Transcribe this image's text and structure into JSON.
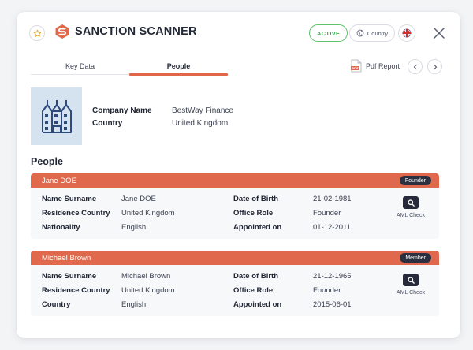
{
  "header": {
    "brand_name": "SANCTION SCANNER",
    "status_badge": "ACTIVE",
    "country_button": "Country"
  },
  "tabs": [
    {
      "label": "Key Data",
      "active": false
    },
    {
      "label": "People",
      "active": true
    }
  ],
  "toolbar": {
    "pdf_label": "Pdf Report",
    "pdf_icon_text": "PDF"
  },
  "company": {
    "name_label": "Company Name",
    "name_value": "BestWay Finance",
    "country_label": "Country",
    "country_value": "United Kingdom"
  },
  "people_title": "People",
  "people": [
    {
      "name": "Jane DOE",
      "role_badge": "Founder",
      "fields": {
        "name_surname_label": "Name Surname",
        "name_surname": "Jane DOE",
        "residence_label": "Residence Country",
        "residence": "United Kingdom",
        "country_label": "Nationality",
        "country": "English",
        "dob_label": "Date of Birth",
        "dob": "21-02-1981",
        "office_role_label": "Office Role",
        "office_role": "Founder",
        "appointed_label": "Appointed on",
        "appointed": "01-12-2011"
      },
      "aml_label": "AML Check"
    },
    {
      "name": "Michael Brown",
      "role_badge": "Member",
      "fields": {
        "name_surname_label": "Name Surname",
        "name_surname": "Michael Brown",
        "residence_label": "Residence Country",
        "residence": "United Kingdom",
        "country_label": "Country",
        "country": "English",
        "dob_label": "Date of Birth",
        "dob": "21-12-1965",
        "office_role_label": "Office Role",
        "office_role": "Founder",
        "appointed_label": "Appointed on",
        "appointed": "2015-06-01"
      },
      "aml_label": "AML Check"
    }
  ],
  "colors": {
    "accent": "#e0694d",
    "active_green": "#3aa64c",
    "dark_badge": "#2c2f3f",
    "company_icon_bg": "#d5e2ef"
  },
  "icons": [
    "star-icon",
    "brand-logo-icon",
    "globe-icon",
    "uk-flag-icon",
    "close-icon",
    "pdf-icon",
    "chevron-left-icon",
    "chevron-right-icon",
    "factory-icon",
    "search-icon"
  ]
}
